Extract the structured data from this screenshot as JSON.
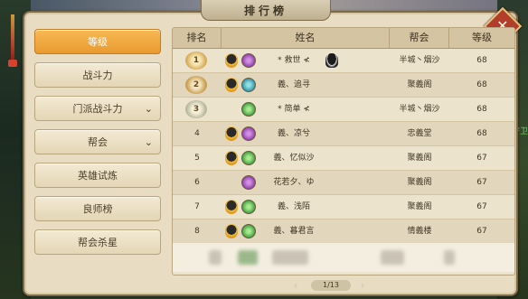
{
  "window": {
    "title": "排行榜",
    "close_label": "✕"
  },
  "scene": {
    "side_notice": "会守卫"
  },
  "sidebar": {
    "items": [
      {
        "label": "等级",
        "active": true,
        "has_dropdown": false
      },
      {
        "label": "战斗力",
        "active": false,
        "has_dropdown": false
      },
      {
        "label": "门派战斗力",
        "active": false,
        "has_dropdown": true
      },
      {
        "label": "帮会",
        "active": false,
        "has_dropdown": true
      },
      {
        "label": "英雄试炼",
        "active": false,
        "has_dropdown": false
      },
      {
        "label": "良师榜",
        "active": false,
        "has_dropdown": false
      },
      {
        "label": "帮会杀星",
        "active": false,
        "has_dropdown": false
      }
    ],
    "chevron": "⌄"
  },
  "table": {
    "headers": {
      "rank": "排名",
      "name": "姓名",
      "guild": "帮会",
      "level": "等级"
    },
    "rows": [
      {
        "rank": "1",
        "name": "* 救世 ≮",
        "guild": "半城丶烟沙",
        "level": "68",
        "badge": "gold",
        "vip": true,
        "class_icon": "purple",
        "qq": true
      },
      {
        "rank": "2",
        "name": "義、追寻",
        "guild": "聚義阁",
        "level": "68",
        "badge": "silver",
        "vip": true,
        "class_icon": "teal",
        "qq": false
      },
      {
        "rank": "3",
        "name": "* 简单 ≮",
        "guild": "半城丶烟沙",
        "level": "68",
        "badge": "bronze",
        "vip": false,
        "class_icon": "green",
        "qq": false
      },
      {
        "rank": "4",
        "name": "義、凉兮",
        "guild": "忠義堂",
        "level": "68",
        "badge": "",
        "vip": true,
        "class_icon": "purple",
        "qq": false
      },
      {
        "rank": "5",
        "name": "義、忆似沙",
        "guild": "聚義阁",
        "level": "67",
        "badge": "",
        "vip": true,
        "class_icon": "green",
        "qq": false
      },
      {
        "rank": "6",
        "name": "花若夕、ゆ",
        "guild": "聚義阁",
        "level": "67",
        "badge": "",
        "vip": false,
        "class_icon": "purple",
        "qq": false
      },
      {
        "rank": "7",
        "name": "義、浅陌",
        "guild": "聚義阁",
        "level": "67",
        "badge": "",
        "vip": true,
        "class_icon": "green",
        "qq": false
      },
      {
        "rank": "8",
        "name": "義、暮君言",
        "guild": "情義楼",
        "level": "67",
        "badge": "",
        "vip": true,
        "class_icon": "green",
        "qq": false
      }
    ]
  },
  "pager": {
    "text": "1/13",
    "prev": "‹",
    "next": "›"
  }
}
